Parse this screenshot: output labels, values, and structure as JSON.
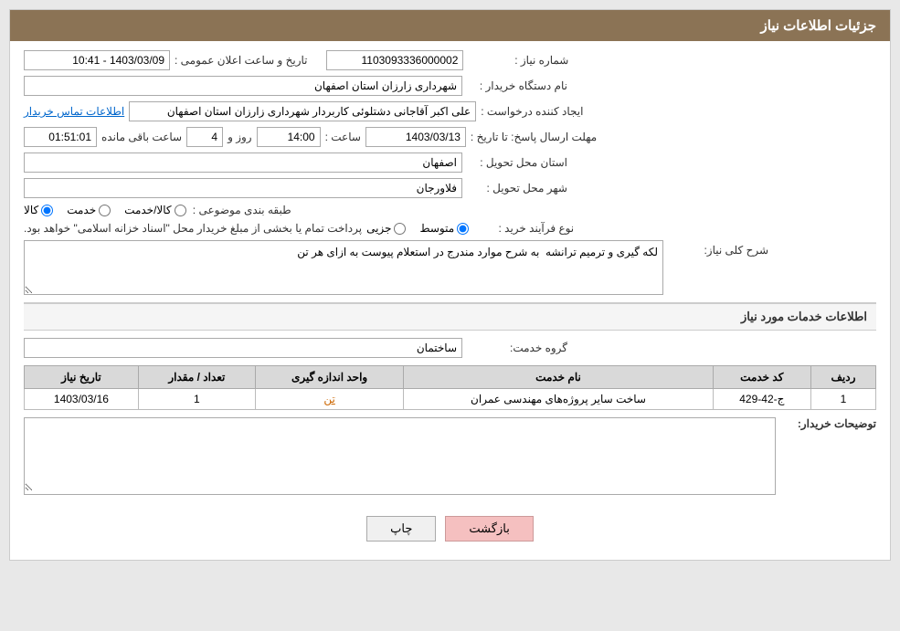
{
  "header": {
    "title": "جزئیات اطلاعات نیاز"
  },
  "fields": {
    "request_number_label": "شماره نیاز :",
    "request_number_value": "1103093336000002",
    "buyer_dept_label": "نام دستگاه خریدار :",
    "buyer_dept_value": "شهرداری زارزان استان اصفهان",
    "requester_label": "ایجاد کننده درخواست :",
    "requester_value": "علی اکبر آقاجانی دشتلوئی کاربردار شهرداری زارزان استان اصفهان",
    "requester_link": "اطلاعات تماس خریدار",
    "deadline_label": "مهلت ارسال پاسخ: تا تاریخ :",
    "deadline_date": "1403/03/13",
    "deadline_time_label": "ساعت :",
    "deadline_time": "14:00",
    "days_label": "روز و",
    "days_value": "4",
    "remaining_label": "ساعت باقی مانده",
    "remaining_time": "01:51:01",
    "announce_label": "تاریخ و ساعت اعلان عمومی :",
    "announce_value": "1403/03/09 - 10:41",
    "province_label": "استان محل تحویل :",
    "province_value": "اصفهان",
    "city_label": "شهر محل تحویل :",
    "city_value": "فلاورجان",
    "category_label": "طبقه بندی موضوعی :",
    "category_options": [
      "کالا",
      "خدمت",
      "کالا/خدمت"
    ],
    "category_selected": "کالا",
    "purchase_type_label": "نوع فرآیند خرید :",
    "purchase_options": [
      "جزیی",
      "متوسط"
    ],
    "purchase_selected": "متوسط",
    "purchase_note": "پرداخت تمام یا بخشی از مبلغ خریدار محل \"اسناد خزانه اسلامی\" خواهد بود.",
    "description_label": "شرح کلی نیاز:",
    "description_value": "لکه گیری و ترمیم ترانشه  به شرح موارد مندرج در استعلام پیوست به ازای هر تن",
    "services_section_title": "اطلاعات خدمات مورد نیاز",
    "service_group_label": "گروه خدمت:",
    "service_group_value": "ساختمان",
    "table": {
      "columns": [
        "ردیف",
        "کد خدمت",
        "نام خدمت",
        "واحد اندازه گیری",
        "تعداد / مقدار",
        "تاریخ نیاز"
      ],
      "rows": [
        {
          "row_num": "1",
          "service_code": "ج-42-429",
          "service_name": "ساخت سایر پروژه‌های مهندسی عمران",
          "unit": "تن",
          "quantity": "1",
          "date": "1403/03/16"
        }
      ]
    },
    "buyer_notes_label": "توضیحات خریدار:",
    "buyer_notes_value": "",
    "buttons": {
      "print": "چاپ",
      "back": "بازگشت"
    }
  },
  "colors": {
    "header_bg": "#8b7355",
    "header_text": "#ffffff",
    "link_color": "#0066cc",
    "unit_link_color": "#cc6600",
    "back_btn_bg": "#f5c0c0"
  }
}
